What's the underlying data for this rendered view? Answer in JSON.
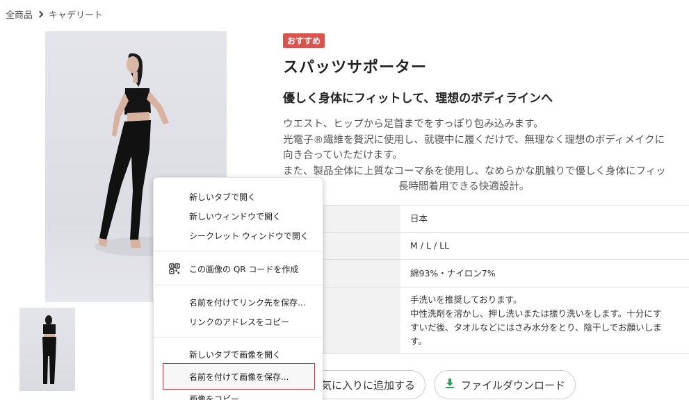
{
  "breadcrumb": {
    "root": "全商品",
    "current": "キャデリート"
  },
  "product": {
    "badge": "おすすめ",
    "title": "スパッツサポーター",
    "subtitle": "優しく身体にフィットして、理想のボディラインへ",
    "description": [
      "ウエスト、ヒップから足首までをすっぽり包み込みます。",
      "光電子®繊維を贅沢に使用し、就寝中に履くだけで、無理なく理想のボディメイクに",
      "向き合っていただけます。",
      "また、製品全体に上質なコーマ糸を使用し、なめらかな肌触りで優しく身体にフィッ",
      "長時間着用できる快適設計。"
    ]
  },
  "specs": [
    {
      "value": "日本"
    },
    {
      "value": "M / L / LL"
    },
    {
      "value": "綿93%・ナイロン7%"
    },
    {
      "lines": [
        "手洗いを推奨しております。",
        "中性洗剤を溶かし、押し洗いまたは振り洗いをします。十分にす",
        "すいだ後、タオルなどにはさみ水分をとり、陰干しでお願いしま",
        "す。"
      ]
    }
  ],
  "buttons": {
    "favorite": "気に入りに追加する",
    "download": "ファイルダウンロード"
  },
  "context_menu": {
    "group1": [
      "新しいタブで開く",
      "新しいウィンドウで開く",
      "シークレット ウィンドウで開く"
    ],
    "qr": "この画像の QR コードを作成",
    "group2": [
      "名前を付けてリンク先を保存...",
      "リンクのアドレスをコピー"
    ],
    "group3": [
      "新しいタブで画像を開く",
      "名前を付けて画像を保存...",
      "画像をコピー"
    ],
    "highlighted_item": "名前を付けて画像を保存..."
  },
  "colors": {
    "badge": "#d9534f",
    "download_icon": "#2e9e5b",
    "highlight_border": "#c0373e"
  }
}
